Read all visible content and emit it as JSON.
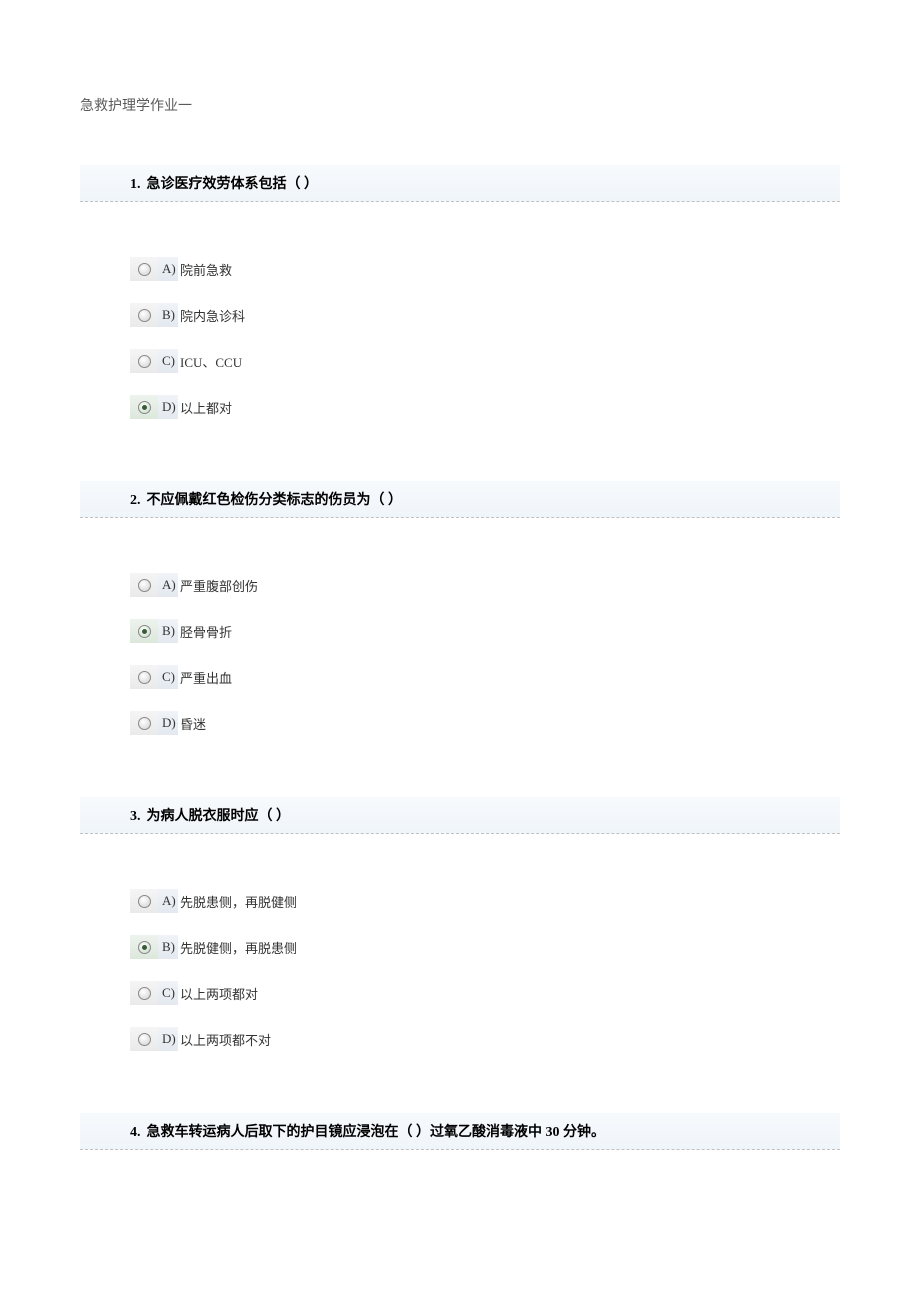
{
  "documentTitle": "急救护理学作业一",
  "questions": [
    {
      "number": "1.",
      "text": "急诊医疗效劳体系包括（ ）",
      "options": [
        {
          "letter": "A)",
          "text": "院前急救",
          "selected": false
        },
        {
          "letter": "B)",
          "text": "院内急诊科",
          "selected": false
        },
        {
          "letter": "C)",
          "text": "ICU、CCU",
          "selected": false
        },
        {
          "letter": "D)",
          "text": "以上都对",
          "selected": true
        }
      ]
    },
    {
      "number": "2.",
      "text": "不应佩戴红色检伤分类标志的伤员为（ ）",
      "options": [
        {
          "letter": "A)",
          "text": "严重腹部创伤",
          "selected": false
        },
        {
          "letter": "B)",
          "text": "胫骨骨折",
          "selected": true
        },
        {
          "letter": "C)",
          "text": "严重出血",
          "selected": false
        },
        {
          "letter": "D)",
          "text": "昏迷",
          "selected": false
        }
      ]
    },
    {
      "number": "3.",
      "text": "为病人脱衣服时应（ ）",
      "options": [
        {
          "letter": "A)",
          "text": "先脱患侧，再脱健侧",
          "selected": false
        },
        {
          "letter": "B)",
          "text": "先脱健侧，再脱患侧",
          "selected": true
        },
        {
          "letter": "C)",
          "text": "以上两项都对",
          "selected": false
        },
        {
          "letter": "D)",
          "text": "以上两项都不对",
          "selected": false
        }
      ]
    },
    {
      "number": "4.",
      "text": "急救车转运病人后取下的护目镜应浸泡在（ ）过氧乙酸消毒液中 30 分钟。",
      "options": []
    }
  ]
}
